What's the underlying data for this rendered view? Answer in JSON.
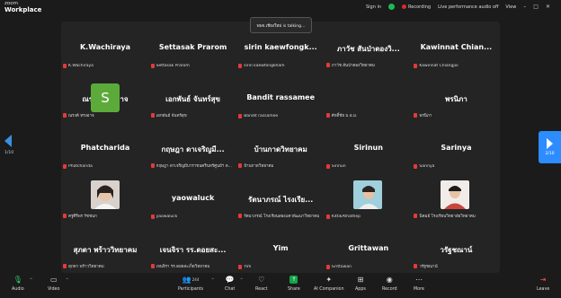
{
  "app": {
    "logo_line1": "zoom",
    "logo_line2": "Workplace"
  },
  "topbar": {
    "sign_in": "Sign in",
    "recording": "Recording",
    "audio_status": "Live performance audio off",
    "view": "View"
  },
  "toast": {
    "text": "พพจ.เชียงใหม่ is talking..."
  },
  "nav": {
    "left_page": "1/10",
    "right_page": "2/10"
  },
  "tiles": [
    {
      "name": "K.Wachiraya",
      "label": "K.Wachiraya"
    },
    {
      "name": "Settasak Prarom",
      "label": "Settasak Prarom"
    },
    {
      "name": "sirin  kaewfongk...",
      "label": "sirin kaewfongkham"
    },
    {
      "name": "ภาวัช สันป่าตองวิ...",
      "label": "ภาวัช สันป่าตองวิทยาคม"
    },
    {
      "name": "Kawinnat  Chian...",
      "label": "Kawinnat Chiangjoi"
    },
    {
      "name": "ณรงค์ ทรงอาจ",
      "label": "ณรงค์ ทรงอาจ"
    },
    {
      "name": "เอกพันธ์ จันทร์สุข",
      "label": "เอกพันธ์ จันทร์สุข"
    },
    {
      "name": "Bandit rassamee",
      "label": "Bandit rassamee"
    },
    {
      "name": "",
      "label": "ศักดิ์ชัย ม.อ.ม.",
      "avatar": "S"
    },
    {
      "name": "พรนิภา",
      "label": "พรนิภา"
    },
    {
      "name": "Phatcharida",
      "label": "Phatcharida"
    },
    {
      "name": "กฤษฎา ดาเจริญมี...",
      "label": "กฤษฎา ดาเจริญมีบาราชนครินทร์ศูนย์ฯ ด..."
    },
    {
      "name": "บ้านกาดวิทยาคม",
      "label": "บ้านกาดวิทยาคม"
    },
    {
      "name": "Sirinun",
      "label": "Sirinun"
    },
    {
      "name": "Sarinya",
      "label": "Sarinya"
    },
    {
      "name": "",
      "label": "ครูศิริพร รัชชนก"
    },
    {
      "name": "yaowaluck",
      "label": "yaowaluck"
    },
    {
      "name": "รัตนาภรณ์ ไรงเรีย...",
      "label": "รัตนาภรณ์ โรงเรียนสองแควพัฒนาวิทยาคม"
    },
    {
      "name": "",
      "label": "KittikAthathep"
    },
    {
      "name": "",
      "label": "นิคมย์ โรงเรียนวิทยาลัยวิทยาคม"
    },
    {
      "name": "สุภดา พร้าววิทยาคม",
      "label": "สุภดา พร้าววิทยาคม"
    },
    {
      "name": "เจนจิรา รร.ดอยสะ...",
      "label": "เจนจิรา รร.ดอยสะเก็ดวิทยาคม"
    },
    {
      "name": "Yim",
      "label": "Yim"
    },
    {
      "name": "Grittawan",
      "label": "Grittawan"
    },
    {
      "name": "วรัฐชณาน์",
      "label": "วรัฐชณาน์"
    }
  ],
  "toolbar": {
    "audio": "Audio",
    "video": "Video",
    "participants": "Participants",
    "participants_count": "244",
    "chat": "Chat",
    "react": "React",
    "share": "Share",
    "ai_companion": "AI Companion",
    "apps": "Apps",
    "record": "Record",
    "more": "More",
    "leave": "Leave"
  }
}
